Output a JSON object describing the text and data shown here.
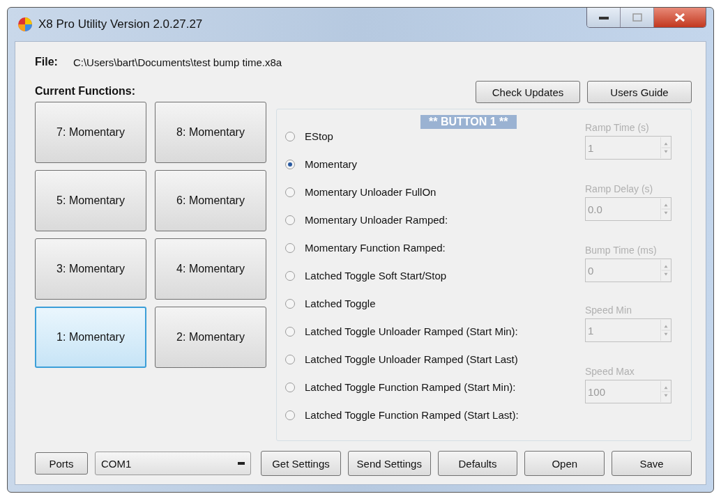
{
  "window": {
    "title": "X8 Pro Utility Version 2.0.27.27"
  },
  "file": {
    "label": "File:",
    "path": "C:\\Users\\bart\\Documents\\test bump time.x8a"
  },
  "functions_label": "Current Functions:",
  "top_buttons": [
    "Check Updates",
    "Users Guide"
  ],
  "function_buttons": [
    {
      "label": "7: Momentary",
      "selected": false
    },
    {
      "label": "8: Momentary",
      "selected": false
    },
    {
      "label": "5: Momentary",
      "selected": false
    },
    {
      "label": "6: Momentary",
      "selected": false
    },
    {
      "label": "3: Momentary",
      "selected": false
    },
    {
      "label": "4: Momentary",
      "selected": false
    },
    {
      "label": "1: Momentary",
      "selected": true
    },
    {
      "label": "2: Momentary",
      "selected": false
    }
  ],
  "panel": {
    "heading": "** BUTTON 1 **",
    "modes": [
      {
        "label": "EStop",
        "checked": false
      },
      {
        "label": "Momentary",
        "checked": true
      },
      {
        "label": "Momentary Unloader FullOn",
        "checked": false
      },
      {
        "label": "Momentary Unloader Ramped:",
        "checked": false
      },
      {
        "label": "Momentary Function Ramped:",
        "checked": false
      },
      {
        "label": "Latched Toggle Soft Start/Stop",
        "checked": false
      },
      {
        "label": "Latched Toggle",
        "checked": false
      },
      {
        "label": "Latched Toggle Unloader Ramped (Start Min):",
        "checked": false
      },
      {
        "label": "Latched Toggle Unloader Ramped (Start Last)",
        "checked": false
      },
      {
        "label": "Latched Toggle Function Ramped (Start Min):",
        "checked": false
      },
      {
        "label": "Latched Toggle Function Ramped (Start Last):",
        "checked": false
      }
    ],
    "settings": [
      {
        "label": "Ramp Time (s)",
        "value": "1",
        "disabled": true
      },
      {
        "label": "Ramp Delay (s)",
        "value": "0.0",
        "disabled": true
      },
      {
        "label": "Bump Time (ms)",
        "value": "0",
        "disabled": true
      },
      {
        "label": "Speed Min",
        "value": "1",
        "disabled": true
      },
      {
        "label": "Speed Max",
        "value": "100",
        "disabled": true
      }
    ]
  },
  "bottom": {
    "ports_button": "Ports",
    "port": "COM1",
    "buttons": [
      "Get Settings",
      "Send Settings",
      "Defaults",
      "Open",
      "Save"
    ]
  }
}
